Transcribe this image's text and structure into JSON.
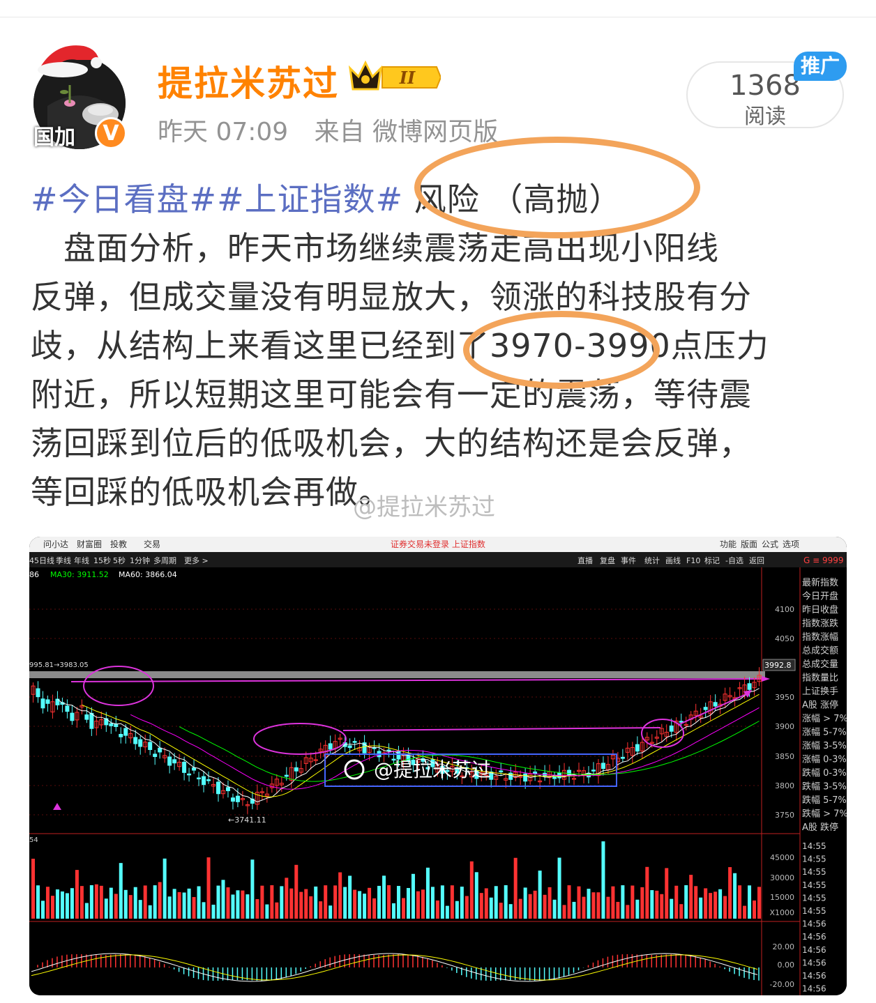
{
  "post": {
    "author": "提拉米苏过",
    "level_badge": "II",
    "avatar_text": "国加",
    "verified_mark": "V",
    "time": "昨天 07:09",
    "source": "来自 微博网页版",
    "read_count": "1368",
    "read_label": "阅读",
    "promo_badge": "推广",
    "hashtags": "#今日看盘##上证指数#",
    "headline": " 风险  （高抛）",
    "lines": [
      "　盘面分析，昨天市场继续震荡走高出现小阳线",
      "反弹，但成交量没有明显放大，领涨的科技股有分",
      "歧，从结构上来看这里已经到了3970-3990点压力",
      "附近，所以短期这里可能会有一定的震荡，等待震",
      "荡回踩到位后的低吸机会，大的结构还是会反弹，",
      "等回踩的低吸机会再做。"
    ],
    "watermark": "@提拉米苏过"
  },
  "chart": {
    "menu": [
      "问小达",
      "财富圈",
      "投教",
      "交易"
    ],
    "title": "证券交易未登录  上证指数",
    "right_menu": [
      "功能",
      "版面",
      "公式",
      "选项"
    ],
    "periods": [
      "45日线",
      "季线",
      "年线",
      "15秒",
      "5秒",
      "1分钟",
      "多周期",
      "更多 >"
    ],
    "tools": [
      "直播",
      "复盘",
      "事件",
      "统计",
      "画线",
      "F10",
      "标记",
      "-自选",
      "返回"
    ],
    "side_code": "G ≡ 9999",
    "ma_legend": [
      "86",
      "MA30: 3911.52",
      "MA60: 3866.04"
    ],
    "price_axis": [
      "4100",
      "4050",
      "3950",
      "3900",
      "3850",
      "3800",
      "3750"
    ],
    "price_tag": "3992.8",
    "high_label": "995.81→3983.05",
    "low_label": "←3741.11",
    "watermark": "@提拉米苏过",
    "vol_axis": [
      "45000",
      "30000",
      "15000",
      "X1000"
    ],
    "vol_top": "54",
    "macd_axis": [
      "20.00",
      "0.00",
      "-20.00"
    ],
    "side_panel": [
      "最新指数",
      "今日开盘",
      "昨日收盘",
      "指数涨跌",
      "指数涨幅",
      "总成交额",
      "总成交量",
      "指数量比",
      "上证换手",
      "A股 涨停",
      "涨幅 > 7%",
      "涨幅 5-7%",
      "涨幅 3-5%",
      "涨幅 0-3%",
      "跌幅 0-3%",
      "跌幅 3-5%",
      "跌幅 5-7%",
      "跌幅 > 7%",
      "A股 跌停"
    ],
    "time_list": [
      "14:55",
      "14:55",
      "14:55",
      "14:55",
      "14:55",
      "14:55",
      "14:56",
      "14:56",
      "14:56",
      "14:56",
      "14:56",
      "14:56"
    ],
    "colors": {
      "up": "#ff3232",
      "down": "#54ffff",
      "ma5": "#ffffff",
      "ma10": "#ffff00",
      "ma20": "#ff00ff",
      "ma30": "#00ff00",
      "highlight": "#dd33dd",
      "box": "#4466ff"
    }
  }
}
